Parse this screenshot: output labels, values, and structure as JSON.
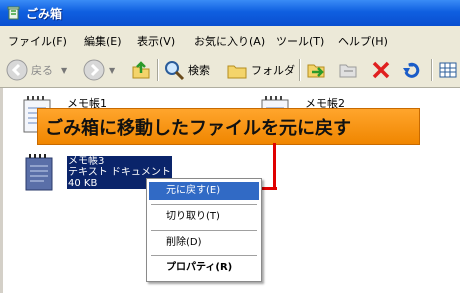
{
  "window": {
    "title": "ごみ箱"
  },
  "menu": [
    "ファイル(F)",
    "編集(E)",
    "表示(V)",
    "お気に入り(A)",
    "ツール(T)",
    "ヘルプ(H)"
  ],
  "toolbar": {
    "back": "戻る",
    "search": "検索",
    "folders": "フォルダ"
  },
  "files": [
    {
      "name": "メモ帳1"
    },
    {
      "name": "メモ帳2"
    },
    {
      "name": "メモ帳3",
      "type": "テキスト ドキュメント",
      "size": "40 KB"
    }
  ],
  "banner": "ごみ箱に移動したファイルを元に戻す",
  "context_menu": [
    "元に戻す(E)",
    "切り取り(T)",
    "削除(D)",
    "プロパティ(R)"
  ],
  "colors": {
    "banner": "#f5960f",
    "highlight": "#316ac5",
    "arrow": "#e00000"
  }
}
